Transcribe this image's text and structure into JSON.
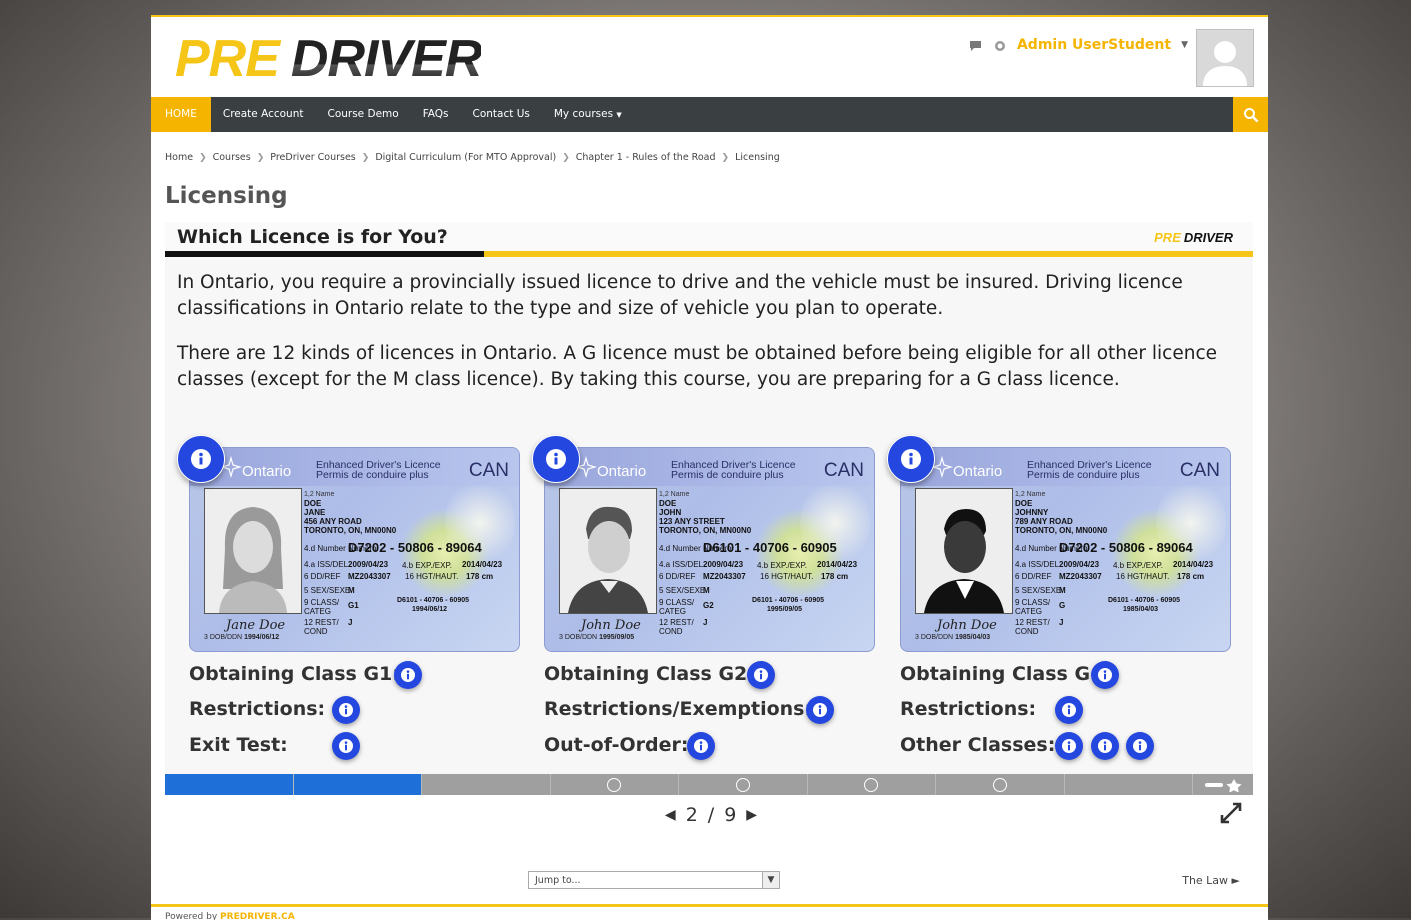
{
  "header": {
    "logo_pre": "PRE",
    "logo_driver": "DRIVER",
    "user_name": "Admin UserStudent",
    "icons": [
      "chat-icon",
      "notification-icon",
      "user-avatar"
    ]
  },
  "nav": {
    "items": [
      {
        "label": "HOME"
      },
      {
        "label": "Create Account"
      },
      {
        "label": "Course Demo"
      },
      {
        "label": "FAQs"
      },
      {
        "label": "Contact Us"
      },
      {
        "label": "My courses"
      }
    ]
  },
  "breadcrumb": [
    "Home",
    "Courses",
    "PreDriver Courses",
    "Digital Curriculum (For MTO Approval)",
    "Chapter 1 - Rules of the Road",
    "Licensing"
  ],
  "page_title": "Licensing",
  "slide": {
    "title": "Which Licence is for You?",
    "logo_pre": "PRE",
    "logo_driver": "DRIVER",
    "para1": "In Ontario, you require a provincially issued licence to drive and the vehicle must be insured. Driving licence classifications in Ontario relate to the type and size of vehicle you plan to operate.",
    "para2": "There are 12 kinds of licences in Ontario. A G licence must be obtained before being eligible for all other licence classes (except for the M class licence). By taking this course, you are preparing for a G class licence.",
    "cards": [
      {
        "province": "Ontario",
        "line1": "Enhanced Driver's Licence",
        "line2": "Permis de conduire plus",
        "country": "CAN",
        "name_label": "1,2 Name",
        "surname": "DOE",
        "given": "JANE",
        "addr1": "456 ANY ROAD",
        "addr2": "TORONTO, ON, MN00N0",
        "number_label": "4.d Number Numéro",
        "number": "D7202 - 50806 - 89064",
        "iss_label": "4.a ISS/DEL",
        "iss": "2009/04/23",
        "exp_label": "4.b EXP./EXP.",
        "exp": "2014/04/23",
        "dd_label": "6 DD/REF",
        "dd": "MZ2043307",
        "hgt_label": "16 HGT/HAUT.",
        "hgt": "178 cm",
        "sex_label": "5 SEX/SEXE",
        "sex": "M",
        "class_label": "9 CLASS/ CATEG",
        "class": "G1",
        "rest_label": "12 REST/ COND",
        "rest": "J",
        "code": "D6101 - 40706 - 60905",
        "code_date": "1994/06/12",
        "signature": "Jane Doe",
        "dob_label": "3 DOB/DDN",
        "dob": "1994/06/12"
      },
      {
        "province": "Ontario",
        "line1": "Enhanced Driver's Licence",
        "line2": "Permis de conduire plus",
        "country": "CAN",
        "name_label": "1,2 Name",
        "surname": "DOE",
        "given": "JOHN",
        "addr1": "123 ANY STREET",
        "addr2": "TORONTO, ON, MN00N0",
        "number_label": "4.d Number Numéro",
        "number": "D6101 - 40706 - 60905",
        "iss_label": "4.a ISS/DEL",
        "iss": "2009/04/23",
        "exp_label": "4.b EXP./EXP.",
        "exp": "2014/04/23",
        "dd_label": "6 DD/REF",
        "dd": "MZ2043307",
        "hgt_label": "16 HGT/HAUT.",
        "hgt": "178 cm",
        "sex_label": "5 SEX/SEXE",
        "sex": "M",
        "class_label": "9 CLASS/ CATEG",
        "class": "G2",
        "rest_label": "12 REST/ COND",
        "rest": "J",
        "code": "D6101 - 40706 - 60905",
        "code_date": "1995/09/05",
        "signature": "John Doe",
        "dob_label": "3 DOB/DDN",
        "dob": "1995/09/05"
      },
      {
        "province": "Ontario",
        "line1": "Enhanced Driver's Licence",
        "line2": "Permis de conduire plus",
        "country": "CAN",
        "name_label": "1,2 Name",
        "surname": "DOE",
        "given": "JOHNNY",
        "addr1": "789 ANY ROAD",
        "addr2": "TORONTO, ON, MN00N0",
        "number_label": "4.d Number Numéro",
        "number": "D7202 - 50806 - 89064",
        "iss_label": "4.a ISS/DEL",
        "iss": "2009/04/23",
        "exp_label": "4.b EXP./EXP.",
        "exp": "2014/04/23",
        "dd_label": "6 DD/REF",
        "dd": "MZ2043307",
        "hgt_label": "16 HGT/HAUT.",
        "hgt": "178 cm",
        "sex_label": "5 SEX/SEXE",
        "sex": "M",
        "class_label": "9 CLASS/ CATEG",
        "class": "G",
        "rest_label": "12 REST/ COND",
        "rest": "J",
        "code": "D6101 - 40706 - 60905",
        "code_date": "1985/04/03",
        "signature": "John Doe",
        "dob_label": "3 DOB/DDN",
        "dob": "1985/04/03"
      }
    ],
    "rows": [
      [
        "Obtaining Class G1:",
        "Obtaining Class G2:",
        "Obtaining Class G:"
      ],
      [
        "Restrictions:",
        "Restrictions/Exemptions:",
        "Restrictions:"
      ],
      [
        "Exit Test:",
        "Out-of-Order:",
        "Other Classes:"
      ]
    ]
  },
  "progress": {
    "total_segments": 8,
    "completed": 2
  },
  "pager": {
    "current": "2",
    "separator": "/",
    "total": "9"
  },
  "jump_to": {
    "placeholder": "Jump to..."
  },
  "next_link": "The Law ►",
  "footer": {
    "prefix": "Powered by",
    "brand": "PREDRIVER.CA"
  },
  "colors": {
    "accent": "#f5b400",
    "nav_bg": "#3a3f42",
    "info_blue": "#2447e0",
    "progress_blue": "#1e6fd8"
  }
}
